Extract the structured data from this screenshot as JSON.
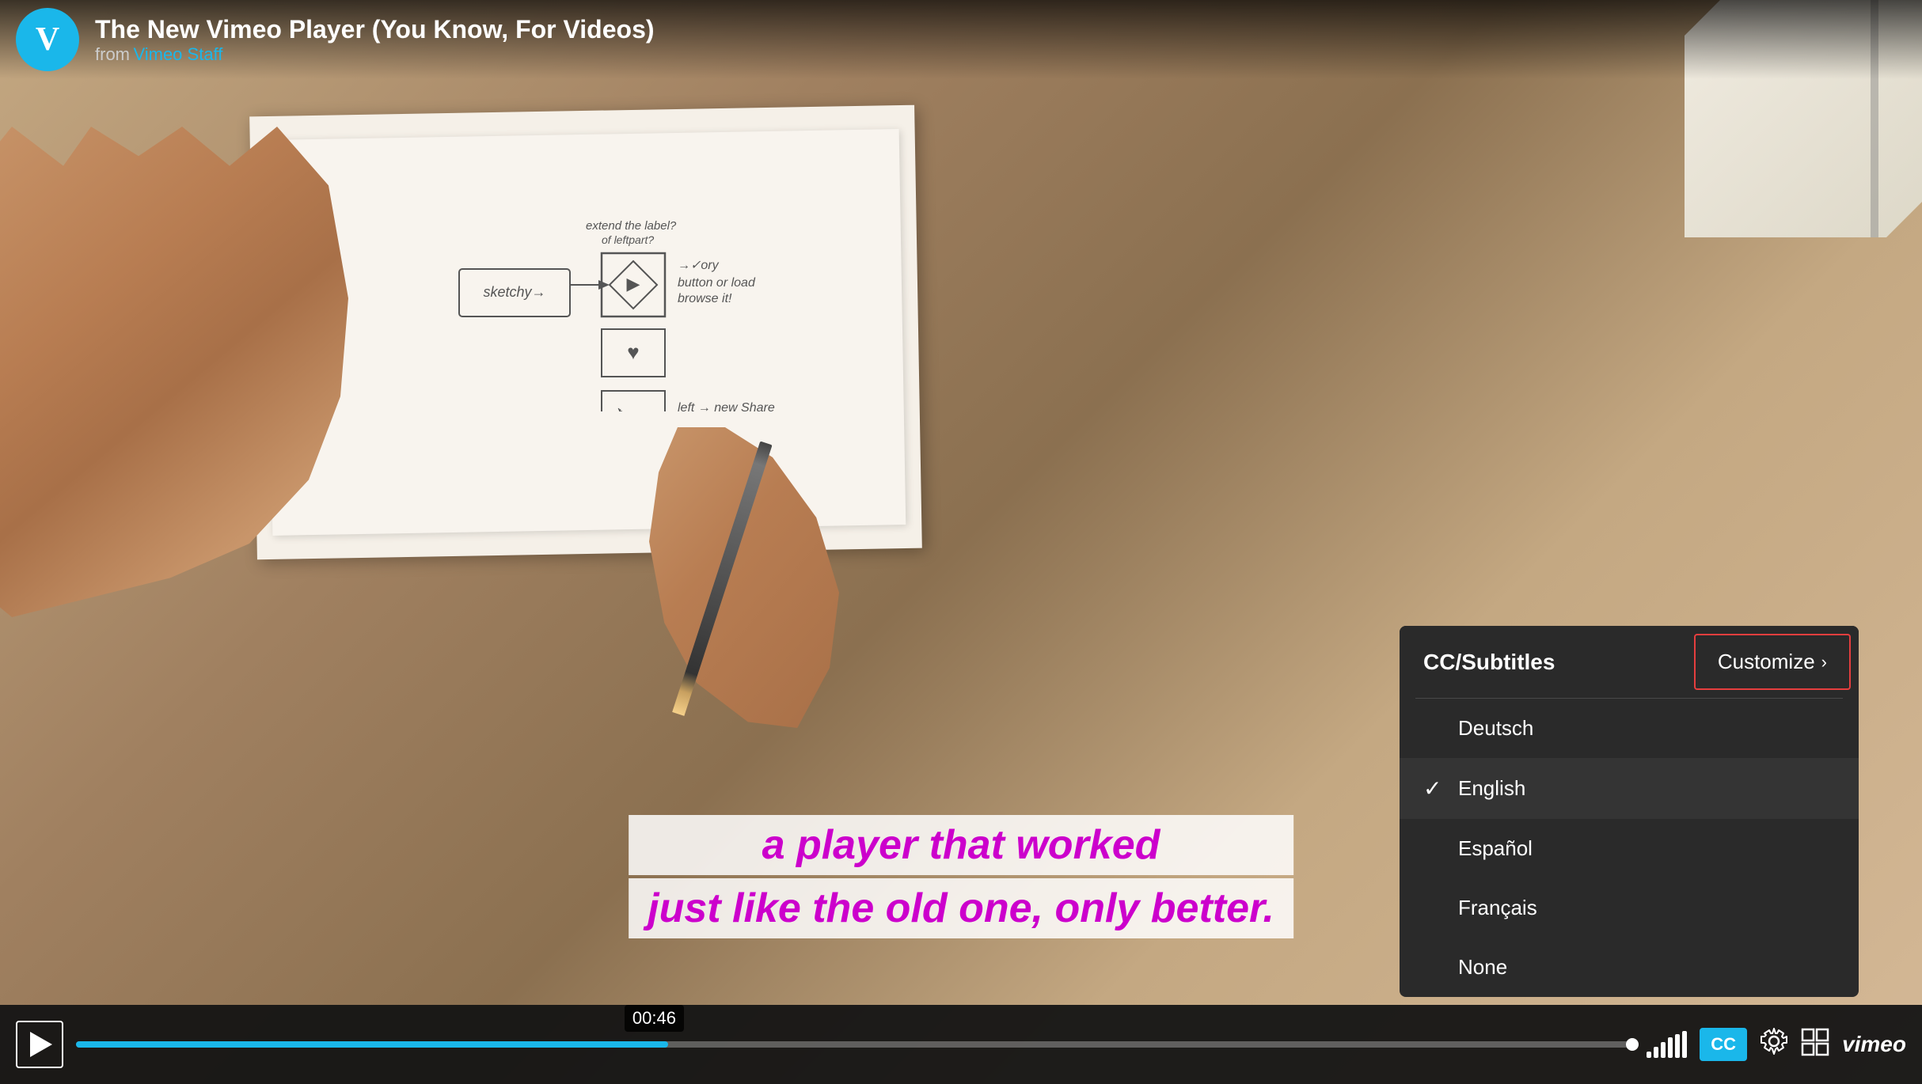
{
  "header": {
    "title": "The New Vimeo Player (You Know, For Videos)",
    "from_label": "from",
    "from_author": "Vimeo Staff"
  },
  "subtitle": {
    "line1": "a player that worked",
    "line2": "just like the old one, only better."
  },
  "controls": {
    "time": "00:46",
    "progress_percent": 38,
    "cc_label": "CC",
    "vimeo_label": "vimeo"
  },
  "cc_dropdown": {
    "title": "CC/Subtitles",
    "customize_label": "Customize",
    "options": [
      {
        "label": "Deutsch",
        "selected": false
      },
      {
        "label": "English",
        "selected": true
      },
      {
        "label": "Español",
        "selected": false
      },
      {
        "label": "Français",
        "selected": false
      },
      {
        "label": "None",
        "selected": false
      }
    ]
  },
  "volume_bars": [
    4,
    8,
    14,
    20,
    26,
    30,
    34
  ]
}
